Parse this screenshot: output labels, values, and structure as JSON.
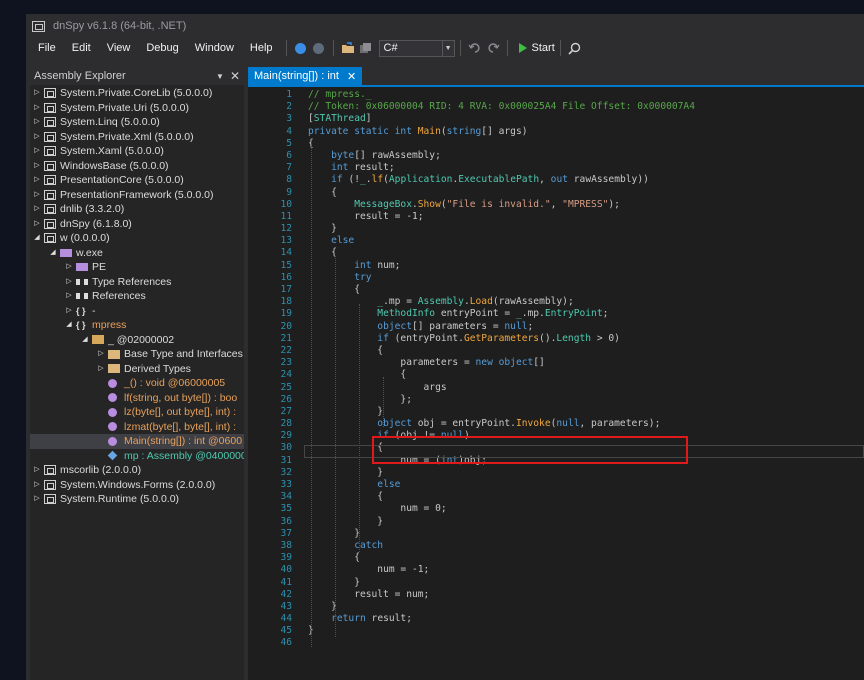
{
  "window": {
    "title": "dnSpy v6.1.8 (64-bit, .NET)"
  },
  "menu": [
    "File",
    "Edit",
    "View",
    "Debug",
    "Window",
    "Help"
  ],
  "toolbar": {
    "language": "C#",
    "start_label": "Start",
    "icons": [
      "back-icon",
      "forward-icon",
      "open-folder-icon",
      "save-all-icon",
      "undo-icon",
      "redo-icon",
      "search-icon"
    ]
  },
  "assembly_explorer": {
    "title": "Assembly Explorer",
    "nodes": [
      {
        "label": "System.Private.CoreLib (5.0.0.0)",
        "indent": 0,
        "expander": "right",
        "icon": "assembly-icon",
        "cls": "t-gray"
      },
      {
        "label": "System.Private.Uri (5.0.0.0)",
        "indent": 0,
        "expander": "right",
        "icon": "assembly-icon",
        "cls": "t-gray"
      },
      {
        "label": "System.Linq (5.0.0.0)",
        "indent": 0,
        "expander": "right",
        "icon": "assembly-icon",
        "cls": "t-gray"
      },
      {
        "label": "System.Private.Xml (5.0.0.0)",
        "indent": 0,
        "expander": "right",
        "icon": "assembly-icon",
        "cls": "t-gray"
      },
      {
        "label": "System.Xaml (5.0.0.0)",
        "indent": 0,
        "expander": "right",
        "icon": "assembly-icon",
        "cls": "t-gray"
      },
      {
        "label": "WindowsBase (5.0.0.0)",
        "indent": 0,
        "expander": "right",
        "icon": "assembly-icon",
        "cls": "t-gray"
      },
      {
        "label": "PresentationCore (5.0.0.0)",
        "indent": 0,
        "expander": "right",
        "icon": "assembly-icon",
        "cls": "t-gray"
      },
      {
        "label": "PresentationFramework (5.0.0.0)",
        "indent": 0,
        "expander": "right",
        "icon": "assembly-icon",
        "cls": "t-gray"
      },
      {
        "label": "dnlib (3.3.2.0)",
        "indent": 0,
        "expander": "right",
        "icon": "assembly-icon",
        "cls": "t-gray"
      },
      {
        "label": "dnSpy (6.1.8.0)",
        "indent": 0,
        "expander": "right",
        "icon": "assembly-icon",
        "cls": "t-gray"
      },
      {
        "label": "w (0.0.0.0)",
        "indent": 0,
        "expander": "down",
        "icon": "assembly-icon",
        "cls": "t-gray"
      },
      {
        "label": "w.exe",
        "indent": 1,
        "expander": "down",
        "icon": "module-icon",
        "cls": "t-gray"
      },
      {
        "label": "PE",
        "indent": 2,
        "expander": "right",
        "icon": "module-icon",
        "cls": "t-gray"
      },
      {
        "label": "Type References",
        "indent": 2,
        "expander": "right",
        "icon": "references-icon",
        "cls": "t-gray"
      },
      {
        "label": "References",
        "indent": 2,
        "expander": "right",
        "icon": "references-icon",
        "cls": "t-gray"
      },
      {
        "label": "-",
        "indent": 2,
        "expander": "right",
        "icon": "namespace-icon",
        "cls": "t-gray"
      },
      {
        "label": "mpress",
        "indent": 2,
        "expander": "down",
        "icon": "namespace-icon",
        "cls": "t-or"
      },
      {
        "label": "_ @02000002",
        "indent": 3,
        "expander": "down",
        "icon": "class-icon",
        "cls": "t-gray"
      },
      {
        "label": "Base Type and Interfaces",
        "indent": 4,
        "expander": "right",
        "icon": "folder-icon",
        "cls": "t-gray"
      },
      {
        "label": "Derived Types",
        "indent": 4,
        "expander": "right",
        "icon": "folder-icon",
        "cls": "t-gray"
      },
      {
        "label": "_() : void @06000005",
        "indent": 4,
        "expander": "",
        "icon": "method-icon",
        "cls": "t-or"
      },
      {
        "label": "lf(string, out byte[]) : boo",
        "indent": 4,
        "expander": "",
        "icon": "method-icon",
        "cls": "t-or"
      },
      {
        "label": "lz(byte[], out byte[], int) :",
        "indent": 4,
        "expander": "",
        "icon": "method-icon",
        "cls": "t-or"
      },
      {
        "label": "lzmat(byte[], byte[], int) :",
        "indent": 4,
        "expander": "",
        "icon": "method-icon",
        "cls": "t-or"
      },
      {
        "label": "Main(string[]) : int @0600",
        "indent": 4,
        "expander": "",
        "icon": "method-icon",
        "cls": "t-or",
        "selected": true
      },
      {
        "label": "mp : Assembly @0400000",
        "indent": 4,
        "expander": "",
        "icon": "field-icon",
        "cls": "t-cyan"
      },
      {
        "label": "mscorlib (2.0.0.0)",
        "indent": 0,
        "expander": "right",
        "icon": "assembly-icon",
        "cls": "t-gray"
      },
      {
        "label": "System.Windows.Forms (2.0.0.0)",
        "indent": 0,
        "expander": "right",
        "icon": "assembly-icon",
        "cls": "t-gray"
      },
      {
        "label": "System.Runtime (5.0.0.0)",
        "indent": 0,
        "expander": "right",
        "icon": "assembly-icon",
        "cls": "t-gray"
      }
    ]
  },
  "editor": {
    "tab_label": "Main(string[]) : int",
    "lines": [
      [
        [
          "cm",
          "// mpress._"
        ]
      ],
      [
        [
          "cm",
          "// Token: 0x06000004 RID: 4 RVA: 0x000025A4 File Offset: 0x000007A4"
        ]
      ],
      [
        [
          "p",
          "["
        ],
        [
          "ty",
          "STAThread"
        ],
        [
          "p",
          "]"
        ]
      ],
      [
        [
          "k",
          "private static int "
        ],
        [
          "m",
          "Main"
        ],
        [
          "p",
          "("
        ],
        [
          "k",
          "string"
        ],
        [
          "p",
          "[] args)"
        ]
      ],
      [
        [
          "p",
          "{"
        ]
      ],
      [
        [
          "k",
          "    byte"
        ],
        [
          "p",
          "[] rawAssembly;"
        ]
      ],
      [
        [
          "k",
          "    int "
        ],
        [
          "p",
          "result;"
        ]
      ],
      [
        [
          "k",
          "    if "
        ],
        [
          "p",
          "(!"
        ],
        [
          "ty",
          "_"
        ],
        [
          "p",
          "."
        ],
        [
          "m",
          "lf"
        ],
        [
          "p",
          "("
        ],
        [
          "ty",
          "Application"
        ],
        [
          "p",
          "."
        ],
        [
          "ty",
          "ExecutablePath"
        ],
        [
          "p",
          ", "
        ],
        [
          "k",
          "out "
        ],
        [
          "p",
          "rawAssembly))"
        ]
      ],
      [
        [
          "p",
          "    {"
        ]
      ],
      [
        [
          "ty",
          "        MessageBox"
        ],
        [
          "p",
          "."
        ],
        [
          "m",
          "Show"
        ],
        [
          "p",
          "("
        ],
        [
          "s",
          "\"File is invalid.\""
        ],
        [
          "p",
          ", "
        ],
        [
          "s",
          "\"MPRESS\""
        ],
        [
          "p",
          ");"
        ]
      ],
      [
        [
          "p",
          "        result = -1;"
        ]
      ],
      [
        [
          "p",
          "    }"
        ]
      ],
      [
        [
          "k",
          "    else"
        ]
      ],
      [
        [
          "p",
          "    {"
        ]
      ],
      [
        [
          "k",
          "        int "
        ],
        [
          "p",
          "num;"
        ]
      ],
      [
        [
          "k",
          "        try"
        ]
      ],
      [
        [
          "p",
          "        {"
        ]
      ],
      [
        [
          "ty",
          "            _"
        ],
        [
          "p",
          ".mp = "
        ],
        [
          "ty",
          "Assembly"
        ],
        [
          "p",
          "."
        ],
        [
          "m",
          "Load"
        ],
        [
          "p",
          "(rawAssembly);"
        ]
      ],
      [
        [
          "ty",
          "            MethodInfo "
        ],
        [
          "p",
          "entryPoint = "
        ],
        [
          "ty",
          "_"
        ],
        [
          "p",
          ".mp."
        ],
        [
          "ty",
          "EntryPoint"
        ],
        [
          "p",
          ";"
        ]
      ],
      [
        [
          "k",
          "            object"
        ],
        [
          "p",
          "[] parameters = "
        ],
        [
          "k",
          "null"
        ],
        [
          "p",
          ";"
        ]
      ],
      [
        [
          "k",
          "            if "
        ],
        [
          "p",
          "(entryPoint."
        ],
        [
          "m",
          "GetParameters"
        ],
        [
          "p",
          "()."
        ],
        [
          "ty",
          "Length "
        ],
        [
          "p",
          "> 0)"
        ]
      ],
      [
        [
          "p",
          "            {"
        ]
      ],
      [
        [
          "p",
          "                parameters = "
        ],
        [
          "k",
          "new object"
        ],
        [
          "p",
          "[]"
        ]
      ],
      [
        [
          "p",
          "                {"
        ]
      ],
      [
        [
          "p",
          "                    args"
        ]
      ],
      [
        [
          "p",
          "                };"
        ]
      ],
      [
        [
          "p",
          "            }"
        ]
      ],
      [
        [
          "k",
          "            object "
        ],
        [
          "p",
          "obj = entryPoint."
        ],
        [
          "m",
          "Invoke"
        ],
        [
          "p",
          "("
        ],
        [
          "k",
          "null"
        ],
        [
          "p",
          ", parameters);"
        ]
      ],
      [
        [
          "k",
          "            if "
        ],
        [
          "p",
          "(obj != "
        ],
        [
          "k",
          "null"
        ],
        [
          "p",
          ")"
        ]
      ],
      [
        [
          "p",
          "            {"
        ]
      ],
      [
        [
          "p",
          "                num = ("
        ],
        [
          "k",
          "int"
        ],
        [
          "p",
          ")obj;"
        ]
      ],
      [
        [
          "p",
          "            }"
        ]
      ],
      [
        [
          "k",
          "            else"
        ]
      ],
      [
        [
          "p",
          "            {"
        ]
      ],
      [
        [
          "p",
          "                num = 0;"
        ]
      ],
      [
        [
          "p",
          "            }"
        ]
      ],
      [
        [
          "p",
          "        }"
        ]
      ],
      [
        [
          "k",
          "        catch"
        ]
      ],
      [
        [
          "p",
          "        {"
        ]
      ],
      [
        [
          "p",
          "            num = -1;"
        ]
      ],
      [
        [
          "p",
          "        }"
        ]
      ],
      [
        [
          "p",
          "        result = num;"
        ]
      ],
      [
        [
          "p",
          "    }"
        ]
      ],
      [
        [
          "k",
          "    return "
        ],
        [
          "p",
          "result;"
        ]
      ],
      [
        [
          "p",
          "}"
        ]
      ],
      [
        [
          "p",
          ""
        ]
      ]
    ]
  }
}
